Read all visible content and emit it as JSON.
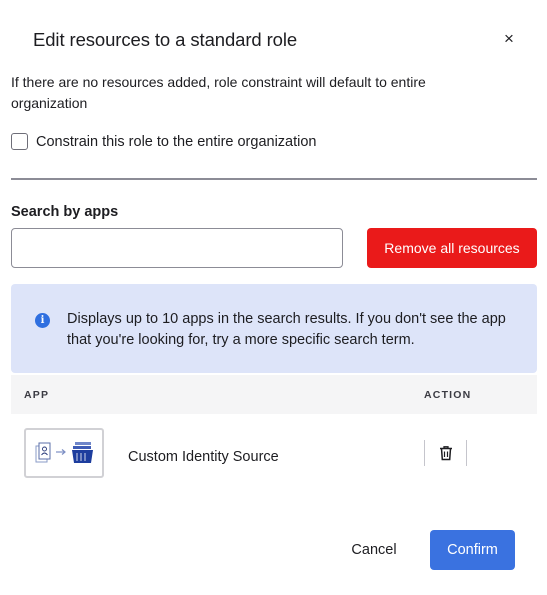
{
  "dialog": {
    "title": "Edit resources to a standard role",
    "close_label": "×",
    "description": "If there are no resources added, role constraint will default to entire organization",
    "constrain_checkbox": {
      "label": "Constrain this role to the entire organization",
      "checked": false
    },
    "search": {
      "label": "Search by apps",
      "value": "",
      "placeholder": ""
    },
    "remove_all_label": "Remove all resources",
    "info": {
      "icon": "info-icon",
      "icon_glyph": "i",
      "text": "Displays up to 10 apps in the search results. If you don't see the app that you're looking for, try a more specific search term."
    },
    "table": {
      "columns": [
        "APP",
        "ACTION"
      ],
      "rows": [
        {
          "app_name": "Custom Identity Source",
          "logo": "custom-identity-source-logo",
          "action_icon": "trash-icon"
        }
      ]
    },
    "footer": {
      "cancel_label": "Cancel",
      "confirm_label": "Confirm"
    }
  },
  "colors": {
    "danger": "#ea1a1a",
    "primary": "#3a72e0",
    "info_bg": "#dde4f9",
    "info_icon": "#2f6fe0",
    "header_bg": "#f5f5f6"
  }
}
